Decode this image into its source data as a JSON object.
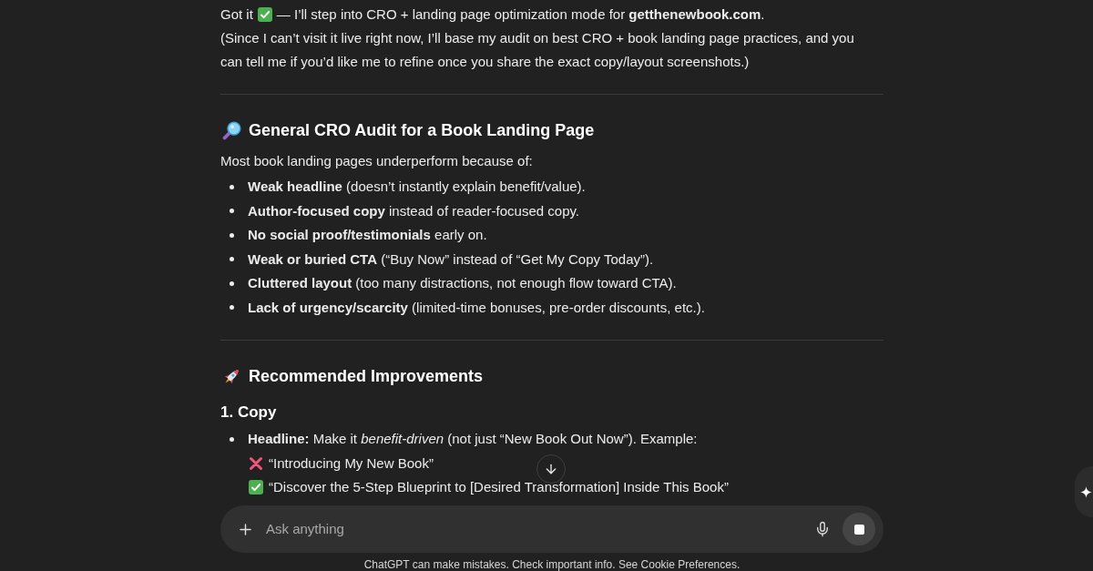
{
  "message": {
    "intro": {
      "lead": "Got it",
      "text": "— I’ll step into CRO + landing page optimization mode for **getthenewbook.com**.",
      "note": "(Since I can’t visit it live right now, I’ll base my audit on best CRO + book landing page practices, and you can tell me if you’d like me to refine once you share the exact copy/layout screenshots.)"
    },
    "sections": [
      {
        "kind": "audit",
        "title": "General CRO Audit for a Book Landing Page",
        "lead": "Most book landing pages underperform because of:",
        "bullets": [
          {
            "text": "**Weak headline** (doesn’t instantly explain benefit/value)."
          },
          {
            "text": "**Author-focused copy** instead of reader-focused copy."
          },
          {
            "text": "**No social proof/testimonials** early on."
          },
          {
            "text": "**Weak or buried CTA** (“Buy Now” instead of “Get My Copy Today”)."
          },
          {
            "text": "**Cluttered layout** (too many distractions, not enough flow toward CTA)."
          },
          {
            "text": "**Lack of urgency/scarcity** (limited-time bonuses, pre-order discounts, etc.)."
          }
        ]
      },
      {
        "kind": "improvements",
        "title": "Recommended Improvements",
        "subsections": [
          {
            "title": "1. Copy",
            "bullets": [
              {
                "text": "**Headline:** Make it *benefit-driven* (not just “New Book Out Now”). Example:",
                "examples": [
                  {
                    "kind": "bad",
                    "text": "“Introducing My New Book”"
                  },
                  {
                    "kind": "good",
                    "text": "“Discover the 5-Step Blueprint to [Desired Transformation] Inside This Book”"
                  }
                ]
              }
            ]
          }
        ]
      }
    ]
  },
  "composer": {
    "placeholder": "Ask anything"
  },
  "footer": "ChatGPT can make mistakes. Check important info. See Cookie Preferences."
}
